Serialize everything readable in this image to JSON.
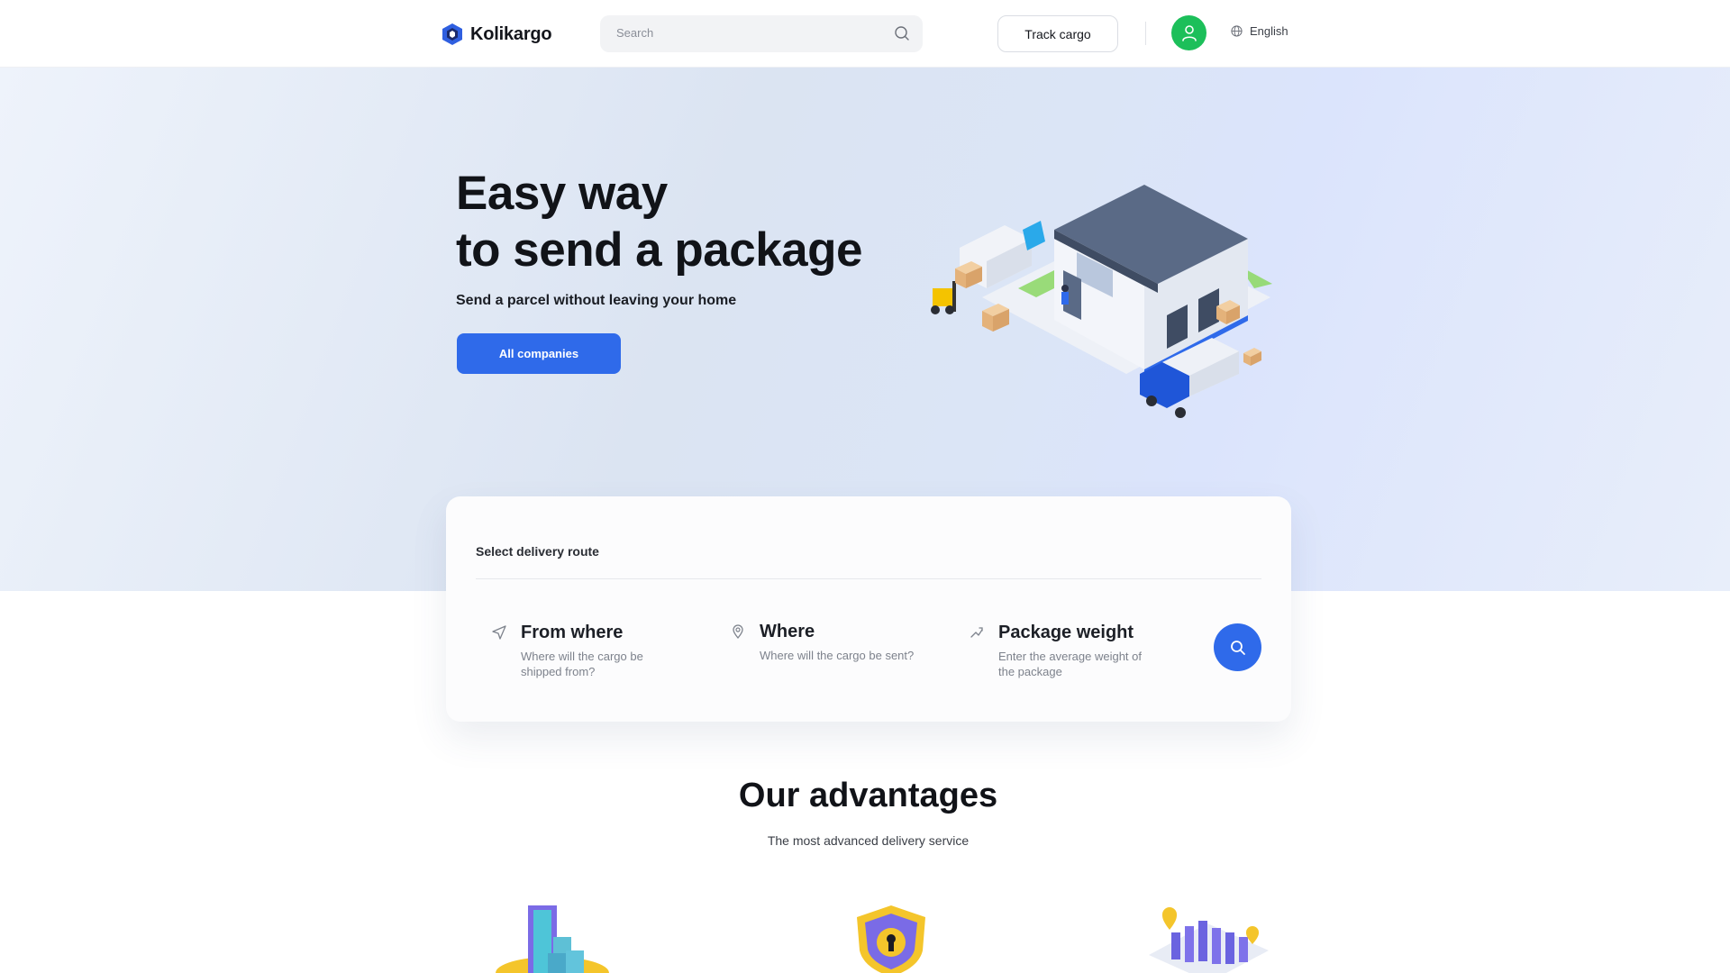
{
  "header": {
    "brand": "Kolikargo",
    "search_placeholder": "Search",
    "track_label": "Track cargo",
    "language": "English"
  },
  "hero": {
    "title_line1": "Easy way",
    "title_line2": "to send a package",
    "subtitle": "Send a parcel without leaving your home",
    "cta_label": "All companies"
  },
  "route": {
    "title": "Select delivery route",
    "fields": [
      {
        "label": "From where",
        "hint": "Where will the cargo be shipped from?",
        "icon": "send-arrow-icon"
      },
      {
        "label": "Where",
        "hint": "Where will the cargo be sent?",
        "icon": "map-pin-icon"
      },
      {
        "label": "Package weight",
        "hint": "Enter the average weight of the package",
        "icon": "weight-icon"
      }
    ]
  },
  "advantages": {
    "title": "Our advantages",
    "subtitle": "The most advanced delivery service"
  },
  "colors": {
    "accent": "#2f6aea",
    "avatar": "#1cbf5a"
  }
}
